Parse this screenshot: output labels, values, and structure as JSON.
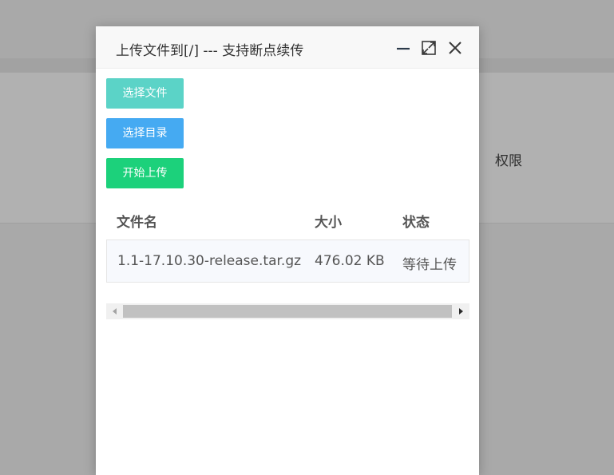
{
  "background": {
    "column_label": "权限"
  },
  "dialog": {
    "title": "上传文件到[/] --- 支持断点续传",
    "minimize_icon": "minimize-icon",
    "maximize_icon": "maximize-icon",
    "close_icon": "close-icon"
  },
  "buttons": {
    "select_file": "选择文件",
    "select_dir": "选择目录",
    "start_upload": "开始上传"
  },
  "colors": {
    "select_file": "#5bd3c7",
    "select_dir": "#45aaf2",
    "start_upload": "#1cd17b"
  },
  "table": {
    "columns": [
      "文件名",
      "大小",
      "状态"
    ],
    "rows": [
      {
        "name": "1.1-17.10.30-release.tar.gz",
        "size": "476.02 KB",
        "status": "等待上传"
      }
    ]
  }
}
